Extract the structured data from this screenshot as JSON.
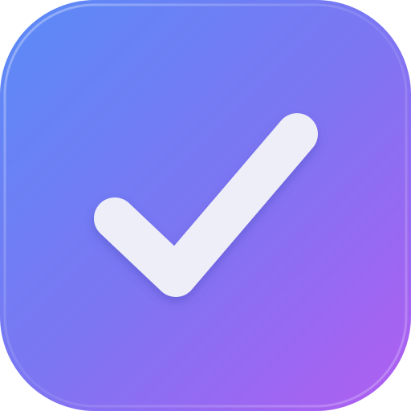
{
  "icon": {
    "name": "checkmark-app-icon",
    "symbol": "check-icon",
    "colors": {
      "gradient_start": "#5A8BF7",
      "gradient_mid": "#7C76F2",
      "gradient_end": "#B15DF1",
      "check": "#EEEEF9",
      "check_shadow": "#4B4BC0",
      "rim_highlight": "#FFFFFF",
      "background": "#FFFFFF"
    }
  }
}
